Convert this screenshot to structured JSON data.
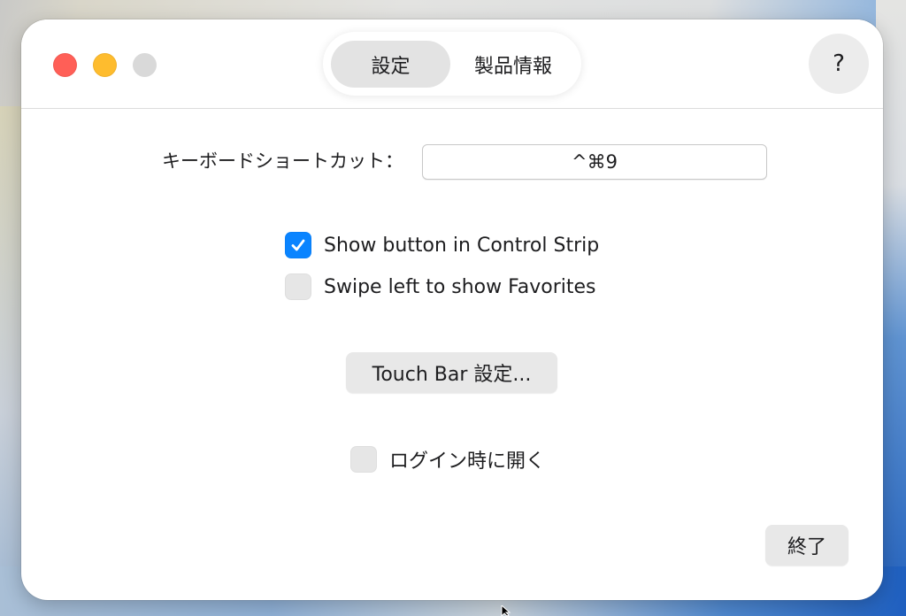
{
  "window": {
    "tabs": [
      {
        "label": "設定",
        "active": true
      },
      {
        "label": "製品情報",
        "active": false
      }
    ],
    "help_label": "?"
  },
  "settings": {
    "shortcut_label": "キーボードショートカット：",
    "shortcut_value": "^⌘9",
    "checkboxes": [
      {
        "label": "Show button in Control Strip",
        "checked": true
      },
      {
        "label": "Swipe left to show Favorites",
        "checked": false
      },
      {
        "label": "ログイン時に開く",
        "checked": false
      }
    ],
    "touchbar_button_label": "Touch Bar 設定...",
    "quit_button_label": "終了"
  },
  "colors": {
    "accent": "#0a84ff",
    "close": "#ff5f57",
    "minimize": "#febc2e",
    "zoom_disabled": "#d9d9d9"
  }
}
